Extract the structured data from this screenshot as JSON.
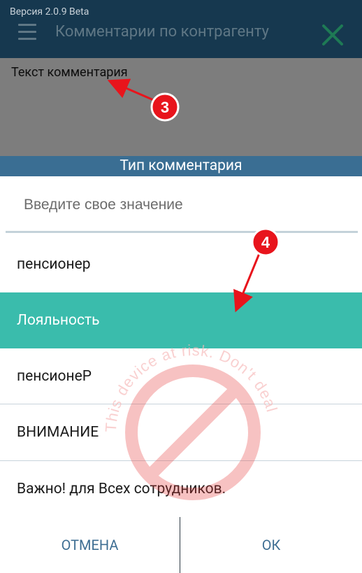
{
  "app_bar": {
    "version": "Версия 2.0.9 Beta",
    "title": "Комментарии по контрагенту",
    "menu_icon": "hamburger-menu-icon",
    "close_icon": "close-x-icon",
    "close_color": "#1e7a55"
  },
  "comment_field": {
    "label": "Текст комментария"
  },
  "dialog": {
    "title": "Тип комментария",
    "search_placeholder": "Введите свое значение",
    "items": [
      {
        "label": "пенсионер",
        "selected": false
      },
      {
        "label": "Лояльность",
        "selected": true
      },
      {
        "label": "пенсионеР",
        "selected": false
      },
      {
        "label": "ВНИМАНИЕ",
        "selected": false
      },
      {
        "label": "Важно! для Всех сотрудников.",
        "selected": false
      }
    ],
    "cancel_label": "ОТМЕНА",
    "ok_label": "ОК"
  },
  "annotations": [
    {
      "number": "3"
    },
    {
      "number": "4"
    }
  ],
  "watermark": {
    "text": "This device at risk. Don't deal",
    "color": "#e63a3a"
  },
  "colors": {
    "app_bar_bg": "#16384f",
    "dialog_title_bg": "#3a6e93",
    "selected_bg": "#3abcac",
    "button_text": "#3e6e93",
    "annotation_red": "#e8141c"
  }
}
